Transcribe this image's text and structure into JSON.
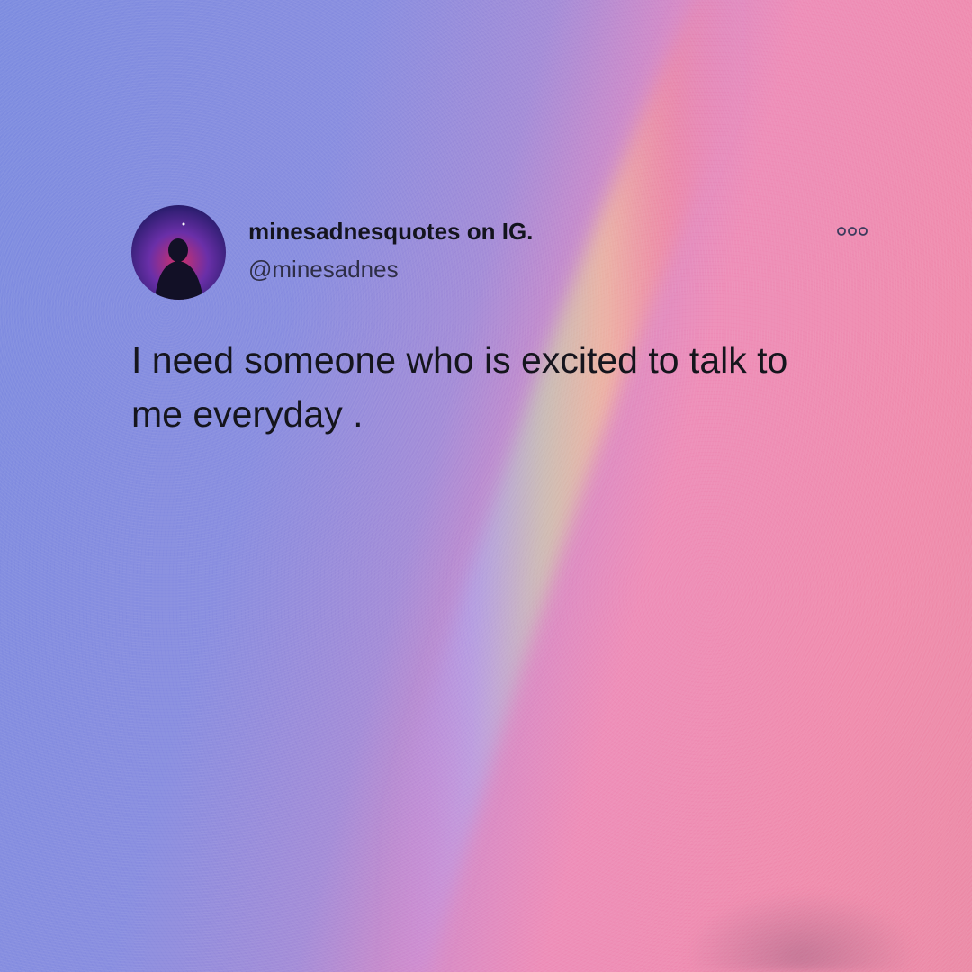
{
  "post": {
    "display_name": "minesadnesquotes on IG.",
    "handle": "@minesadnes",
    "text": "I need someone who is excited to talk to me everyday .",
    "avatar_icon": "profile-avatar-silhouette",
    "more_icon": "more-options-icon"
  },
  "colors": {
    "text_primary": "#14141e",
    "text_secondary": "#2e2e46",
    "bg_blue": "#8a8fe0",
    "bg_pink": "#f08eae"
  }
}
